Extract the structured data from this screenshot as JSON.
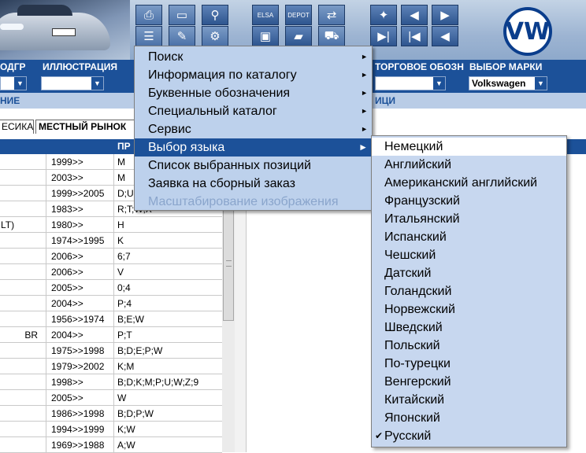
{
  "header": {
    "logo": "VW",
    "toolbar_icons": [
      "printer-icon",
      "book-icon",
      "binoculars-icon",
      "form-icon",
      "pencil-icon",
      "wheel-icon",
      "elsa-icon",
      "depot-icon",
      "cart-transfer-icon",
      "pin-icon",
      "page-prev-icon",
      "page-next-icon",
      "monitor-icon",
      "van-icon",
      "cart-icon",
      "first-icon",
      "prev-icon",
      "back-icon"
    ],
    "elsa_label": "ELSA",
    "depot_label": "DEPOT"
  },
  "columns": {
    "c1": "ОДГР",
    "c2": "ИЛЛЮСТРАЦИЯ",
    "c3": "ТОРГОВОЕ ОБОЗН",
    "c4": "ВЫБОР МАРКИ",
    "brand_value": "Volkswagen",
    "sub1": "НИЕ",
    "sub2": "ИЦИ"
  },
  "tabs": {
    "tab1": "ЕСИКА",
    "tab2": "МЕСТНЫЙ РЫНОК"
  },
  "table_header": {
    "h3": "ПР"
  },
  "table_rows": [
    {
      "c0": "",
      "c0r": "",
      "years": "1999>>",
      "codes": "M"
    },
    {
      "c0": "",
      "c0r": "",
      "years": "2003>>",
      "codes": "M"
    },
    {
      "c0": "",
      "c0r": "",
      "years": "1999>>2005",
      "codes": "D;U"
    },
    {
      "c0": "",
      "c0r": "",
      "years": "1983>>",
      "codes": "R;T;W;X"
    },
    {
      "c0": "LT)",
      "c0r": "",
      "years": "1980>>",
      "codes": "H"
    },
    {
      "c0": "",
      "c0r": "",
      "years": "1974>>1995",
      "codes": "K"
    },
    {
      "c0": "",
      "c0r": "",
      "years": "2006>>",
      "codes": "6;7"
    },
    {
      "c0": "",
      "c0r": "",
      "years": "2006>>",
      "codes": "V"
    },
    {
      "c0": "",
      "c0r": "",
      "years": "2005>>",
      "codes": "0;4"
    },
    {
      "c0": "",
      "c0r": "",
      "years": "2004>>",
      "codes": "P;4"
    },
    {
      "c0": "",
      "c0r": "",
      "years": "1956>>1974",
      "codes": "B;E;W"
    },
    {
      "c0": "",
      "c0r": "BR",
      "years": "2004>>",
      "codes": "P;T"
    },
    {
      "c0": "",
      "c0r": "",
      "years": "1975>>1998",
      "codes": "B;D;E;P;W"
    },
    {
      "c0": "",
      "c0r": "",
      "years": "1979>>2002",
      "codes": "K;M"
    },
    {
      "c0": "",
      "c0r": "",
      "years": "1998>>",
      "codes": "B;D;K;M;P;U;W;Z;9"
    },
    {
      "c0": "",
      "c0r": "",
      "years": "2005>>",
      "codes": "W"
    },
    {
      "c0": "",
      "c0r": "",
      "years": "1986>>1998",
      "codes": "B;D;P;W"
    },
    {
      "c0": "",
      "c0r": "",
      "years": "1994>>1999",
      "codes": "K;W"
    },
    {
      "c0": "",
      "c0r": "",
      "years": "1969>>1988",
      "codes": "A;W"
    }
  ],
  "menu": [
    {
      "label": "Поиск",
      "sub": true
    },
    {
      "label": "Информация по каталогу",
      "sub": true
    },
    {
      "label": "Буквенные обозначения",
      "sub": true
    },
    {
      "label": "Специальный каталог",
      "sub": true
    },
    {
      "label": "Сервис",
      "sub": true
    },
    {
      "label": "Выбор языка",
      "sub": true,
      "highlighted": true
    },
    {
      "label": "Список выбранных позиций",
      "sub": false
    },
    {
      "label": "Заявка на сборный заказ",
      "sub": false
    },
    {
      "label": "Масштабирование изображения",
      "sub": false,
      "disabled": true
    }
  ],
  "submenu": [
    {
      "label": "Немецкий",
      "highlighted": true
    },
    {
      "label": "Английский"
    },
    {
      "label": "Американский английский"
    },
    {
      "label": "Французский"
    },
    {
      "label": "Итальянский"
    },
    {
      "label": "Испанский"
    },
    {
      "label": "Чешский"
    },
    {
      "label": "Датский"
    },
    {
      "label": "Голандский"
    },
    {
      "label": "Норвежский"
    },
    {
      "label": "Шведский"
    },
    {
      "label": "Польский"
    },
    {
      "label": "По-турецки"
    },
    {
      "label": "Венгерский"
    },
    {
      "label": "Китайский"
    },
    {
      "label": "Японский"
    },
    {
      "label": "Русский",
      "checked": true
    }
  ],
  "glyphs": {
    "submenu_arrow": "►",
    "check": "✔",
    "combo_arrow": "▼"
  },
  "colors": {
    "header_blue": "#1c5199",
    "menu_bg": "#bdd1ec",
    "highlight": "#1c5199"
  }
}
